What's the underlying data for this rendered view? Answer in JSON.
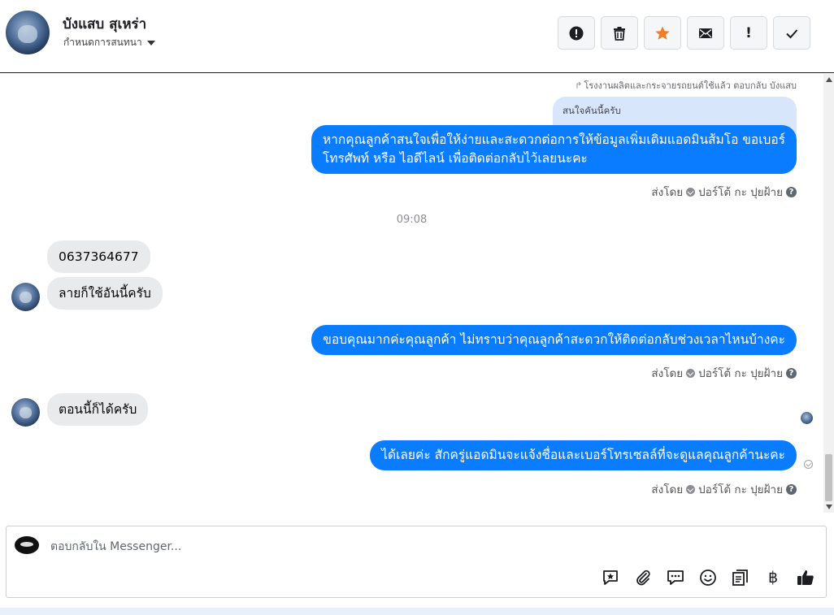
{
  "header": {
    "contact_name": "บังแสบ สุเหร่า",
    "conversation_menu_label": "กำหนดการสนทนา",
    "toolbar_icons": [
      "alert-circle-icon",
      "trash-icon",
      "star-icon",
      "envelope-icon",
      "exclamation-icon",
      "check-icon"
    ],
    "accent_star_color": "#f27d24"
  },
  "conversation": {
    "reply_context": "โรงงานผลิตและกระจายรถยนต์ใช้แล้ว ตอบกลับ บังแสบ",
    "quoted_message": "สนใจคันนี้ครับ",
    "message_1_line_1": "หากคุณลูกค้าสนใจเพื่อให้ง่ายและสะดวกต่อการให้ข้อมูลเพิ่มเติมแอดมินส้มโอ ขอเบอร์",
    "message_1_line_2": "โทรศัพท์ หรือ ไอดีไลน์ เพื่อติดต่อกลับไว้เลยนะคะ",
    "sent_by_label": "ส่งโดย",
    "sender_name": "ปอร์โต้ กะ ปุยฝ้าย",
    "help_glyph": "?",
    "timestamp": "09:08",
    "incoming_1": "0637364677",
    "incoming_2": "ลายก็ใช้อันนี้ครับ",
    "message_2": "ขอบคุณมากค่ะคุณลูกค้า ไม่ทราบว่าคุณลูกค้าสะดวกให้ติดต่อกลับช่วงเวลาไหนบ้างคะ",
    "incoming_3": "ตอนนี้ก็ได้ครับ",
    "message_3": "ได้เลยค่ะ สักครู่แอดมินจะแจ้งชื่อและเบอร์โทรเซลล์ที่จะดูแลคุณลูกค้านะคะ",
    "bubble_out_color": "#0a7cff",
    "bubble_in_color": "#e9eaec"
  },
  "composer": {
    "placeholder": "ตอบกลับใน Messenger...",
    "tool_icons": [
      "saved-reply-icon",
      "paperclip-icon",
      "chat-bubbles-icon",
      "emoji-icon",
      "catalog-icon",
      "baht-icon",
      "thumbs-up-icon"
    ],
    "baht_glyph": "฿"
  }
}
